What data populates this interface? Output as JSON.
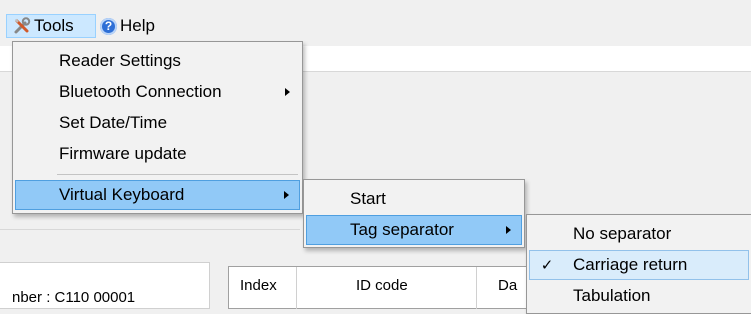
{
  "menubar": {
    "tools_label": "Tools",
    "help_label": "Help",
    "tools_icon": "wrench-screwdriver-icon",
    "help_icon": "help-circle-icon"
  },
  "tools_menu": {
    "items": [
      {
        "label": "Reader Settings"
      },
      {
        "label": "Bluetooth Connection"
      },
      {
        "label": "Set Date/Time"
      },
      {
        "label": "Firmware update"
      },
      {
        "label": "Virtual Keyboard"
      }
    ]
  },
  "virtual_keyboard_menu": {
    "items": [
      {
        "label": "Start"
      },
      {
        "label": "Tag separator"
      }
    ]
  },
  "tag_separator_menu": {
    "items": [
      {
        "label": "No separator",
        "checked": false
      },
      {
        "label": "Carriage return",
        "checked": true
      },
      {
        "label": "Tabulation",
        "checked": false
      }
    ],
    "check_glyph": "✓"
  },
  "background": {
    "serial_text": "nber :  C110 00001",
    "grid_headers": [
      "Index",
      "ID code",
      "Da"
    ]
  },
  "colors": {
    "highlight": "#91c9f7",
    "menubar_active": "#cce8ff"
  }
}
